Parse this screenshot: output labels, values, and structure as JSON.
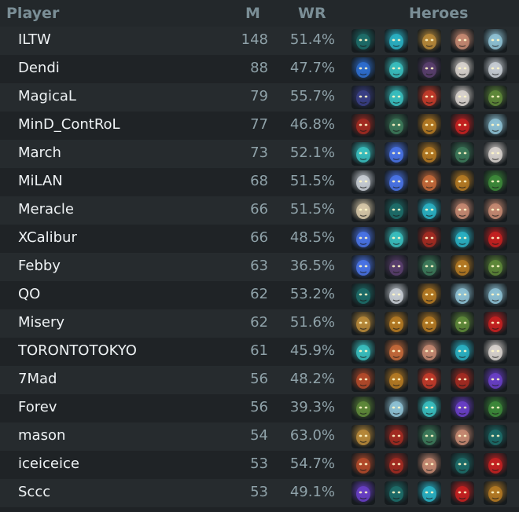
{
  "headers": {
    "player": "Player",
    "matches": "M",
    "winrate": "WR",
    "heroes": "Heroes"
  },
  "rows": [
    {
      "name": "ILTW",
      "m": "148",
      "wr": "51.4%",
      "heroes": [
        {
          "icon": "dark-hero-icon",
          "color": "#1d6d6a"
        },
        {
          "icon": "teal-hero-icon",
          "color": "#2ab1c4"
        },
        {
          "icon": "helmet-hero-icon",
          "color": "#b88a3a"
        },
        {
          "icon": "bearded-hero-icon",
          "color": "#c78a72"
        },
        {
          "icon": "frost-hero-icon",
          "color": "#8fc3d6"
        }
      ]
    },
    {
      "name": "Dendi",
      "m": "88",
      "wr": "47.7%",
      "heroes": [
        {
          "icon": "blue-beast-hero-icon",
          "color": "#2e6fd0"
        },
        {
          "icon": "spectral-hero-icon",
          "color": "#39c0c0"
        },
        {
          "icon": "masked-hero-icon",
          "color": "#5b3f6f"
        },
        {
          "icon": "elder-hero-icon",
          "color": "#d9d3cf"
        },
        {
          "icon": "wolf-hero-icon",
          "color": "#c9cfd6"
        }
      ]
    },
    {
      "name": "MagicaL",
      "m": "79",
      "wr": "55.7%",
      "heroes": [
        {
          "icon": "rogue-hero-icon",
          "color": "#3a3f86"
        },
        {
          "icon": "spectral-hero-icon",
          "color": "#39c0c0"
        },
        {
          "icon": "fire-hero-icon",
          "color": "#c33b2a"
        },
        {
          "icon": "elder-hero-icon",
          "color": "#d9d3cf"
        },
        {
          "icon": "goblin-hero-icon",
          "color": "#5f8a3a"
        }
      ]
    },
    {
      "name": "MinD_ContRoL",
      "m": "77",
      "wr": "46.8%",
      "heroes": [
        {
          "icon": "demon-hero-icon",
          "color": "#a52b22"
        },
        {
          "icon": "golem-hero-icon",
          "color": "#3d7a5a"
        },
        {
          "icon": "gold-hero-icon",
          "color": "#b57a23"
        },
        {
          "icon": "red-beast-hero-icon",
          "color": "#c72121"
        },
        {
          "icon": "frost-hero-icon",
          "color": "#8fc3d6"
        }
      ]
    },
    {
      "name": "March",
      "m": "73",
      "wr": "52.1%",
      "heroes": [
        {
          "icon": "spectral-hero-icon",
          "color": "#39c0c0"
        },
        {
          "icon": "arc-hero-icon",
          "color": "#4a74e8"
        },
        {
          "icon": "gold-hero-icon",
          "color": "#b57a23"
        },
        {
          "icon": "golem-hero-icon",
          "color": "#3d7a5a"
        },
        {
          "icon": "elder-hero-icon",
          "color": "#d9d3cf"
        }
      ]
    },
    {
      "name": "MiLAN",
      "m": "68",
      "wr": "51.5%",
      "heroes": [
        {
          "icon": "wolf-hero-icon",
          "color": "#c9cfd6"
        },
        {
          "icon": "arc-hero-icon",
          "color": "#4a74e8"
        },
        {
          "icon": "woman-hero-icon",
          "color": "#c56a3a"
        },
        {
          "icon": "gold-hero-icon",
          "color": "#b57a23"
        },
        {
          "icon": "shadow-hero-icon",
          "color": "#3d8a3a"
        }
      ]
    },
    {
      "name": "Meracle",
      "m": "66",
      "wr": "51.5%",
      "heroes": [
        {
          "icon": "monk-hero-icon",
          "color": "#d8c9a9"
        },
        {
          "icon": "dark-hero-icon",
          "color": "#1d6d6a"
        },
        {
          "icon": "teal-hero-icon",
          "color": "#2ab1c4"
        },
        {
          "icon": "bearded-hero-icon",
          "color": "#c78a72"
        },
        {
          "icon": "bearded-hero-icon",
          "color": "#c78a72"
        }
      ]
    },
    {
      "name": "XCalibur",
      "m": "66",
      "wr": "48.5%",
      "heroes": [
        {
          "icon": "arc-hero-icon",
          "color": "#4a74e8"
        },
        {
          "icon": "spectral-hero-icon",
          "color": "#39c0c0"
        },
        {
          "icon": "demon-hero-icon",
          "color": "#a52b22"
        },
        {
          "icon": "teal-hero-icon",
          "color": "#2ab1c4"
        },
        {
          "icon": "red-beast-hero-icon",
          "color": "#c72121"
        }
      ]
    },
    {
      "name": "Febby",
      "m": "63",
      "wr": "36.5%",
      "heroes": [
        {
          "icon": "arc-hero-icon",
          "color": "#4a74e8"
        },
        {
          "icon": "masked-hero-icon",
          "color": "#5b3f6f"
        },
        {
          "icon": "golem-hero-icon",
          "color": "#3d7a5a"
        },
        {
          "icon": "gold-hero-icon",
          "color": "#b57a23"
        },
        {
          "icon": "goblin-hero-icon",
          "color": "#5f8a3a"
        }
      ]
    },
    {
      "name": "QO",
      "m": "62",
      "wr": "53.2%",
      "heroes": [
        {
          "icon": "dark-hero-icon",
          "color": "#1d6d6a"
        },
        {
          "icon": "wolf-hero-icon",
          "color": "#c9cfd6"
        },
        {
          "icon": "gold-hero-icon",
          "color": "#b57a23"
        },
        {
          "icon": "frost-hero-icon",
          "color": "#8fc3d6"
        },
        {
          "icon": "frost-hero-icon",
          "color": "#8fc3d6"
        }
      ]
    },
    {
      "name": "Misery",
      "m": "62",
      "wr": "51.6%",
      "heroes": [
        {
          "icon": "helmet-hero-icon",
          "color": "#b88a3a"
        },
        {
          "icon": "gold-hero-icon",
          "color": "#b57a23"
        },
        {
          "icon": "gold-hero-icon",
          "color": "#b57a23"
        },
        {
          "icon": "goblin-hero-icon",
          "color": "#5f8a3a"
        },
        {
          "icon": "red-beast-hero-icon",
          "color": "#c72121"
        }
      ]
    },
    {
      "name": "TORONTOTOKYO",
      "m": "61",
      "wr": "45.9%",
      "heroes": [
        {
          "icon": "spectral-hero-icon",
          "color": "#39c0c0"
        },
        {
          "icon": "woman-hero-icon",
          "color": "#c56a3a"
        },
        {
          "icon": "bearded-hero-icon",
          "color": "#c78a72"
        },
        {
          "icon": "teal-hero-icon",
          "color": "#2ab1c4"
        },
        {
          "icon": "elder-hero-icon",
          "color": "#d9d3cf"
        }
      ]
    },
    {
      "name": "7Mad",
      "m": "56",
      "wr": "48.2%",
      "heroes": [
        {
          "icon": "monkey-hero-icon",
          "color": "#b44a2a"
        },
        {
          "icon": "gold-hero-icon",
          "color": "#b57a23"
        },
        {
          "icon": "fire-hero-icon",
          "color": "#c33b2a"
        },
        {
          "icon": "demon-hero-icon",
          "color": "#a52b22"
        },
        {
          "icon": "void-hero-icon",
          "color": "#6a3fc8"
        }
      ]
    },
    {
      "name": "Forev",
      "m": "56",
      "wr": "39.3%",
      "heroes": [
        {
          "icon": "goblin-hero-icon",
          "color": "#5f8a3a"
        },
        {
          "icon": "frost-hero-icon",
          "color": "#8fc3d6"
        },
        {
          "icon": "spectral-hero-icon",
          "color": "#39c0c0"
        },
        {
          "icon": "void-hero-icon",
          "color": "#6a3fc8"
        },
        {
          "icon": "shadow-hero-icon",
          "color": "#3d8a3a"
        }
      ]
    },
    {
      "name": "mason",
      "m": "54",
      "wr": "63.0%",
      "heroes": [
        {
          "icon": "helmet-hero-icon",
          "color": "#b88a3a"
        },
        {
          "icon": "demon-hero-icon",
          "color": "#a52b22"
        },
        {
          "icon": "golem-hero-icon",
          "color": "#3d7a5a"
        },
        {
          "icon": "bearded-hero-icon",
          "color": "#c78a72"
        },
        {
          "icon": "dark-hero-icon",
          "color": "#1d6d6a"
        }
      ]
    },
    {
      "name": "iceiceice",
      "m": "53",
      "wr": "54.7%",
      "heroes": [
        {
          "icon": "monkey-hero-icon",
          "color": "#b44a2a"
        },
        {
          "icon": "demon-hero-icon",
          "color": "#a52b22"
        },
        {
          "icon": "bearded-hero-icon",
          "color": "#c78a72"
        },
        {
          "icon": "dark-hero-icon",
          "color": "#1d6d6a"
        },
        {
          "icon": "red-beast-hero-icon",
          "color": "#c72121"
        }
      ]
    },
    {
      "name": "Sccc",
      "m": "53",
      "wr": "49.1%",
      "heroes": [
        {
          "icon": "void-hero-icon",
          "color": "#6a3fc8"
        },
        {
          "icon": "dark-hero-icon",
          "color": "#1d6d6a"
        },
        {
          "icon": "teal-hero-icon",
          "color": "#2ab1c4"
        },
        {
          "icon": "red-beast-hero-icon",
          "color": "#c72121"
        },
        {
          "icon": "gold-hero-icon",
          "color": "#b57a23"
        }
      ]
    }
  ]
}
